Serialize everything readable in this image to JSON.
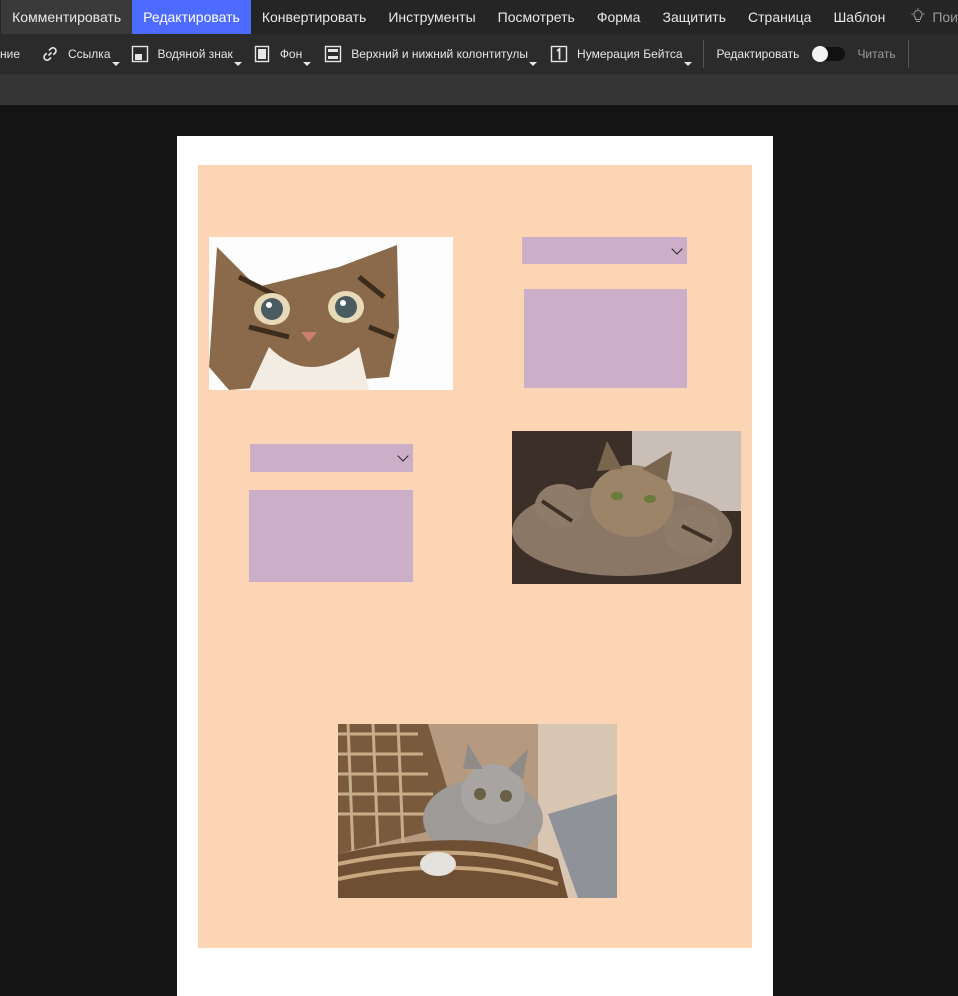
{
  "menu": {
    "items": [
      "Комментировать",
      "Редактировать",
      "Конвертировать",
      "Инструменты",
      "Посмотреть",
      "Форма",
      "Защитить",
      "Страница",
      "Шаблон"
    ],
    "active_index": 1,
    "tip_label": "Пои",
    "tip_icon": "lightbulb-icon"
  },
  "toolbar": {
    "cut_label": "ние",
    "link_label": "Ссылка",
    "watermark_label": "Водяной знак",
    "background_label": "Фон",
    "header_footer_label": "Верхний и нижний колонтитулы",
    "bates_label": "Нумерация Бейтса",
    "edit_label": "Редактировать",
    "read_label": "Читать",
    "edit_mode_on": false
  },
  "colors": {
    "accent": "#4d6bfe",
    "canvas_bg": "#fcd5b4",
    "field_bg": "#ccaec8",
    "app_bg": "#141414"
  }
}
